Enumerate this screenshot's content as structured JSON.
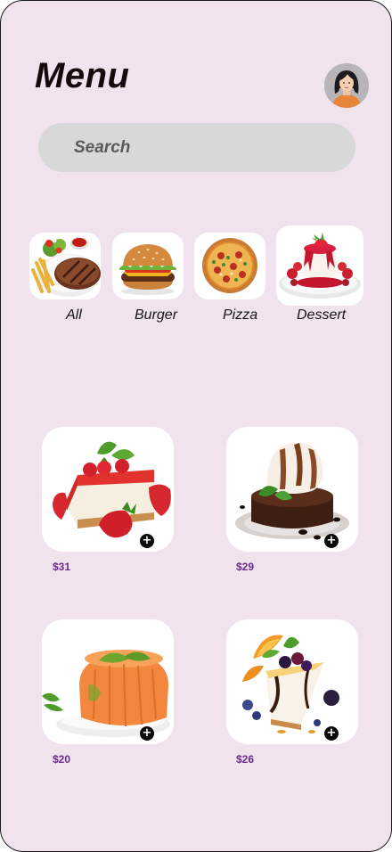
{
  "header": {
    "title": "Menu",
    "avatar_icon": "user-avatar-icon"
  },
  "search": {
    "placeholder": "Search",
    "value": ""
  },
  "categories": [
    {
      "label": "All",
      "image": "steak-fries-plate"
    },
    {
      "label": "Burger",
      "image": "burger"
    },
    {
      "label": "Pizza",
      "image": "pizza"
    },
    {
      "label": "Dessert",
      "image": "panna-cotta"
    }
  ],
  "products": [
    {
      "price": "$31",
      "image": "strawberry-cheesecake",
      "add_icon": "plus-icon"
    },
    {
      "price": "$29",
      "image": "lava-cake-ice-cream",
      "add_icon": "plus-icon"
    },
    {
      "price": "$20",
      "image": "orange-jelly",
      "add_icon": "plus-icon"
    },
    {
      "price": "$26",
      "image": "berry-cheesecake-slice",
      "add_icon": "plus-icon"
    }
  ],
  "colors": {
    "background": "#f1e3ee",
    "search_bg": "#d9d8d9",
    "price": "#6a2a8a",
    "title": "#160a0d"
  }
}
